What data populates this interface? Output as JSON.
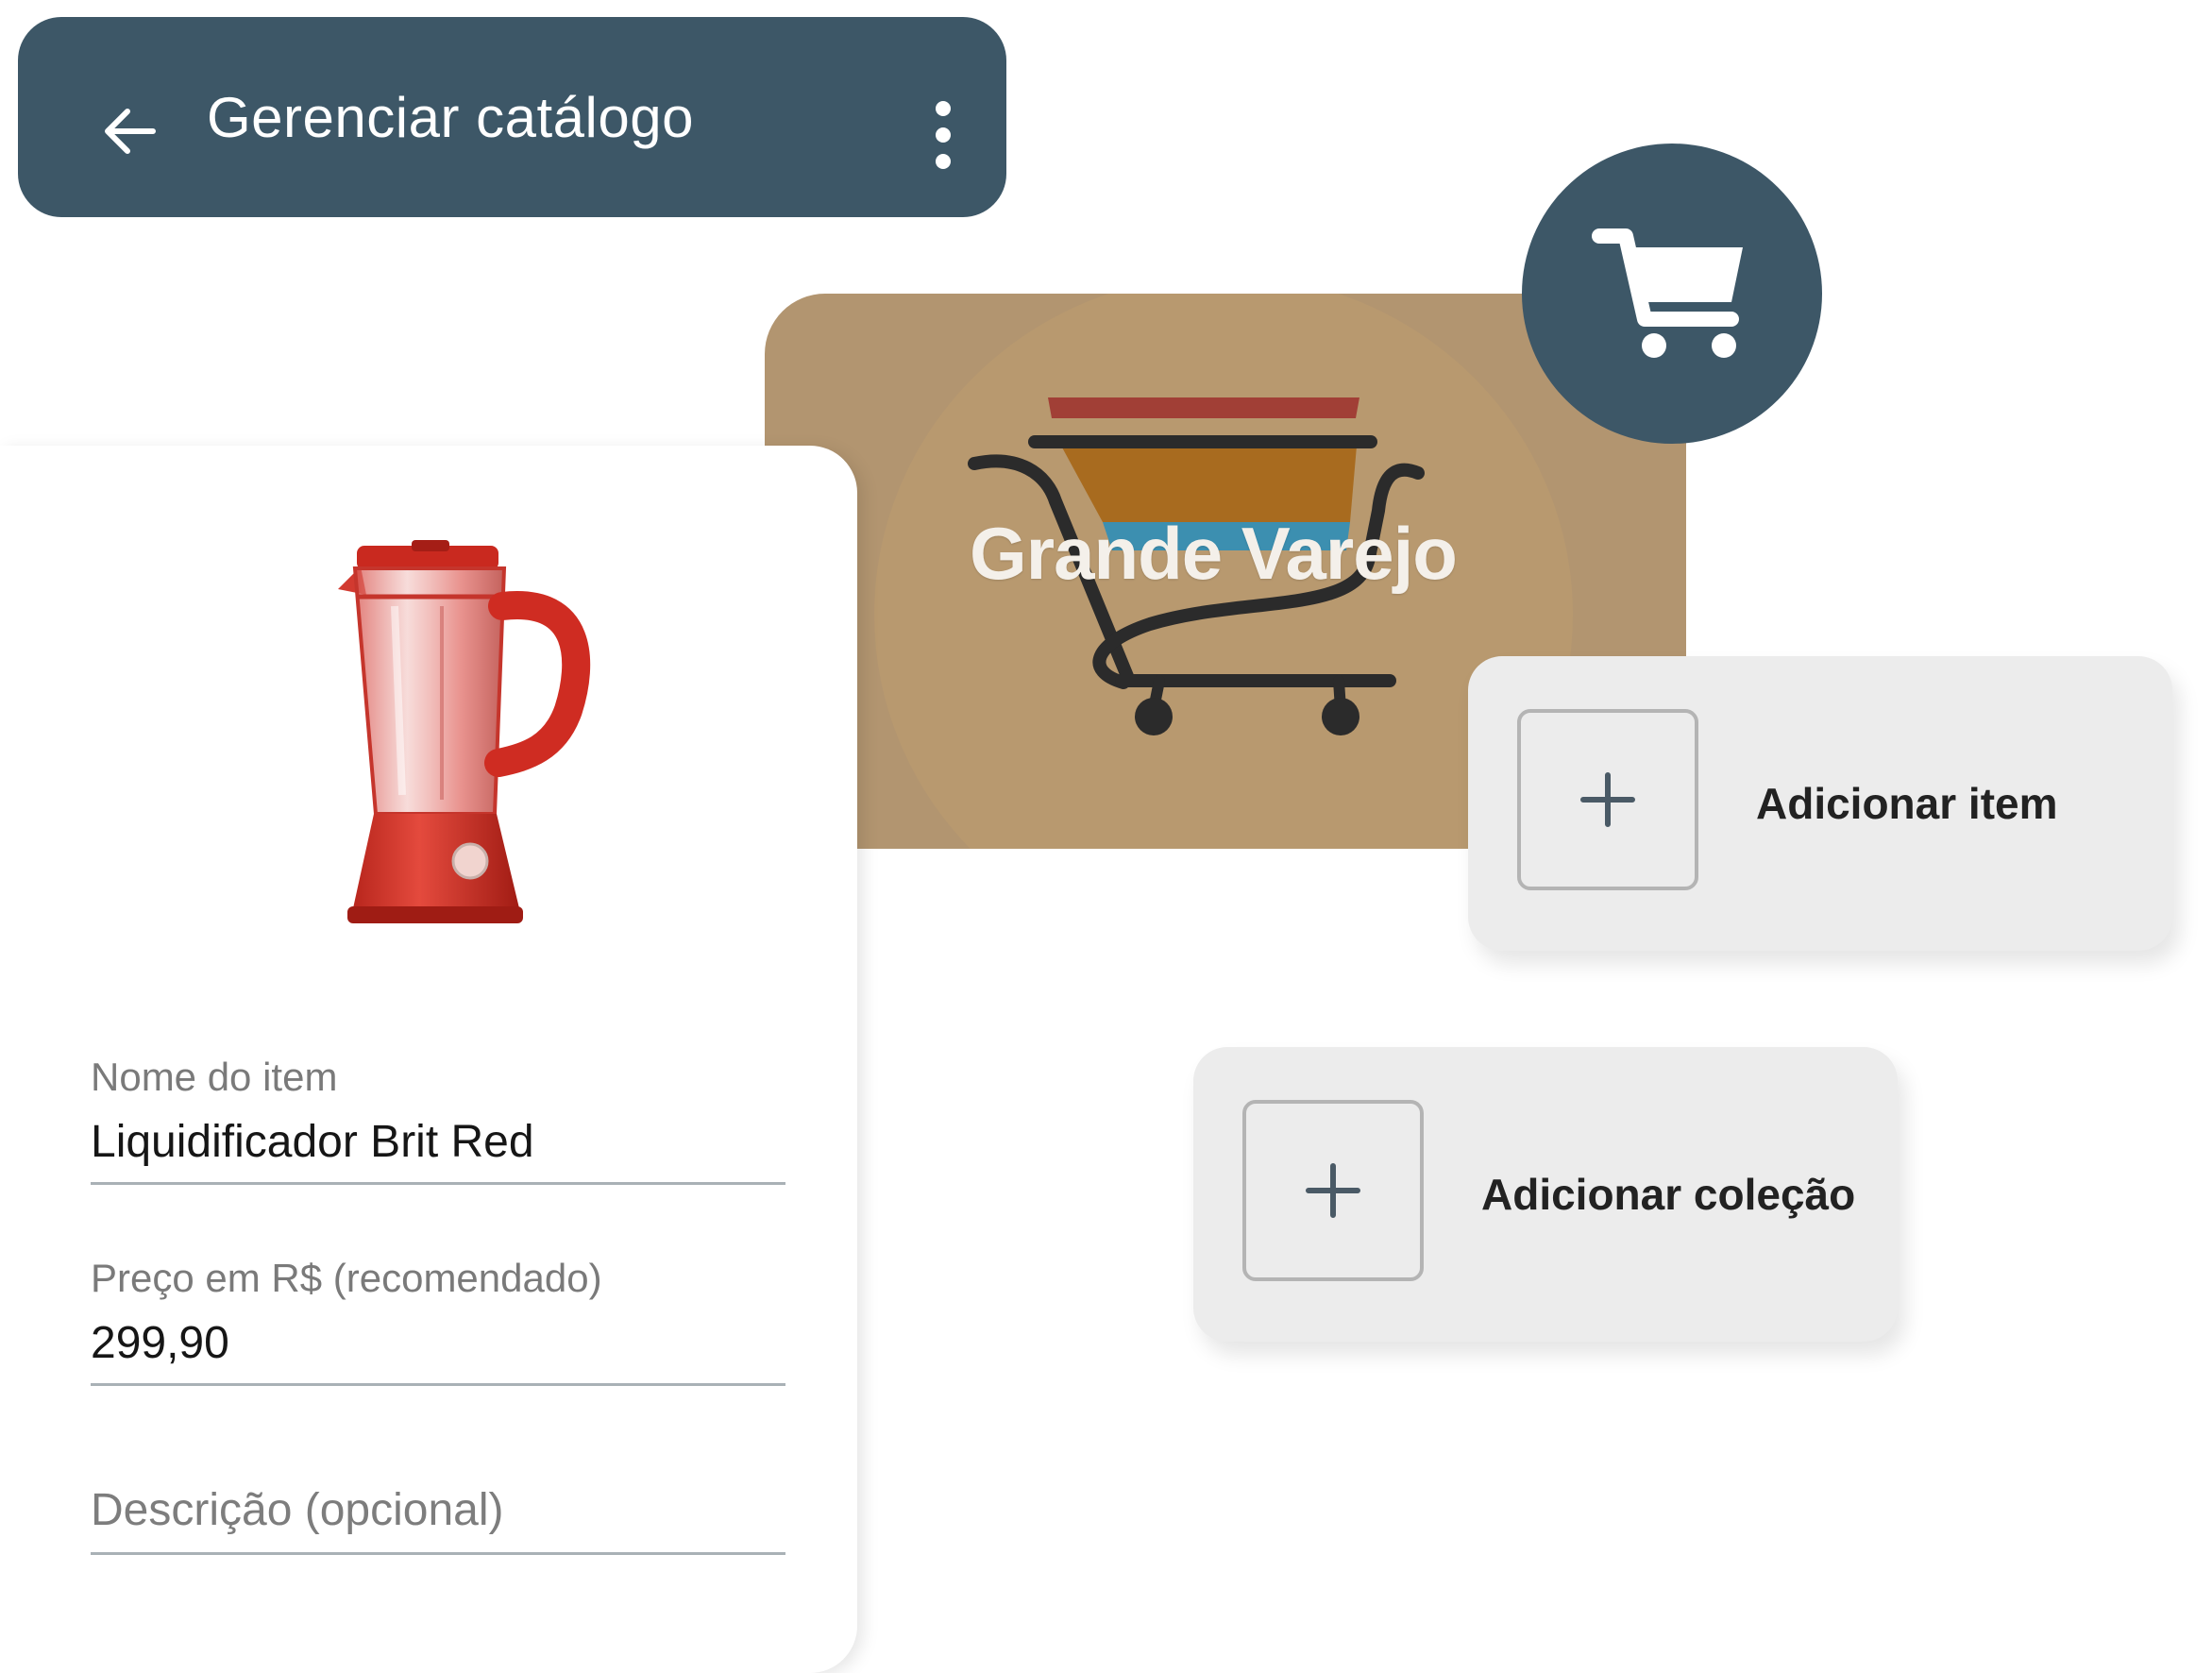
{
  "header": {
    "title": "Gerenciar catálogo",
    "back_icon": "arrow-left-icon",
    "menu_icon": "more-vertical-icon",
    "background_color": "#3d5767"
  },
  "store": {
    "name": "Grande Varejo",
    "cover_color": "#b29570",
    "logo": "shopping-cart-logo",
    "badge_icon": "shopping-cart-icon"
  },
  "item_form": {
    "image": "red-blender-product-image",
    "fields": {
      "name": {
        "label": "Nome do item",
        "value": "Liquidificador Brit Red"
      },
      "price": {
        "label": "Preço em R$ (recomendado)",
        "value": "299,90"
      },
      "description": {
        "placeholder": "Descrição (opcional)",
        "value": ""
      }
    }
  },
  "actions": {
    "add_item": {
      "label": "Adicionar item",
      "icon": "plus-icon"
    },
    "add_collection": {
      "label": "Adicionar coleção",
      "icon": "plus-icon"
    }
  }
}
